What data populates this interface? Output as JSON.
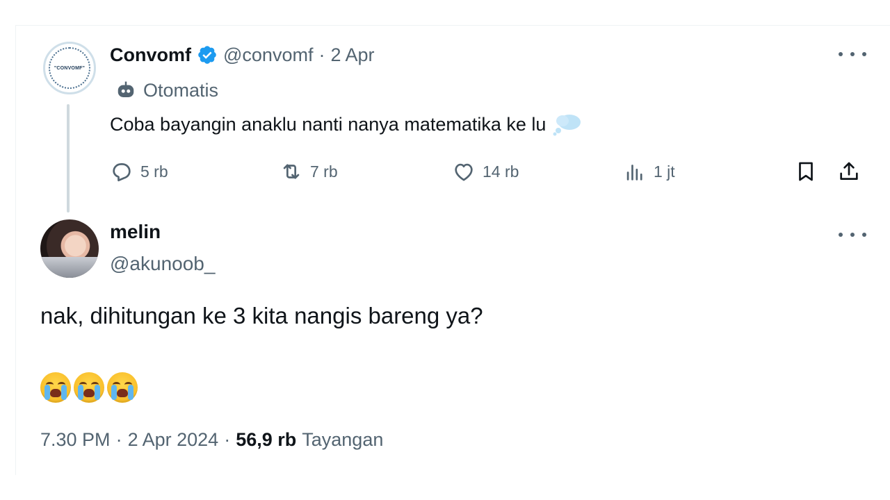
{
  "parent_tweet": {
    "display_name": "Convomf",
    "handle": "@convomf",
    "separator": "·",
    "date": "2 Apr",
    "avatar_text": "\"CONVOMF\"",
    "label": "Otomatis",
    "text": "Coba bayangin anaklu nanti nanya matematika ke lu",
    "emoji_icon": "thought-bubble-icon",
    "stats": {
      "replies": "5 rb",
      "retweets": "7 rb",
      "likes": "14 rb",
      "views": "1 jt"
    }
  },
  "reply_tweet": {
    "display_name": "melin",
    "handle": "@akunoob_",
    "text": "nak, dihitungan ke 3 kita nangis bareng ya?",
    "emojis": [
      "crying-face-icon",
      "crying-face-icon",
      "crying-face-icon"
    ],
    "time": "7.30 PM",
    "sep1": "·",
    "date": "2 Apr 2024",
    "sep2": "·",
    "views_count": "56,9 rb",
    "views_label": "Tayangan"
  },
  "colors": {
    "text": "#0f1419",
    "muted": "#536471",
    "verified": "#1d9bf0",
    "thread_line": "#cfd9de"
  }
}
